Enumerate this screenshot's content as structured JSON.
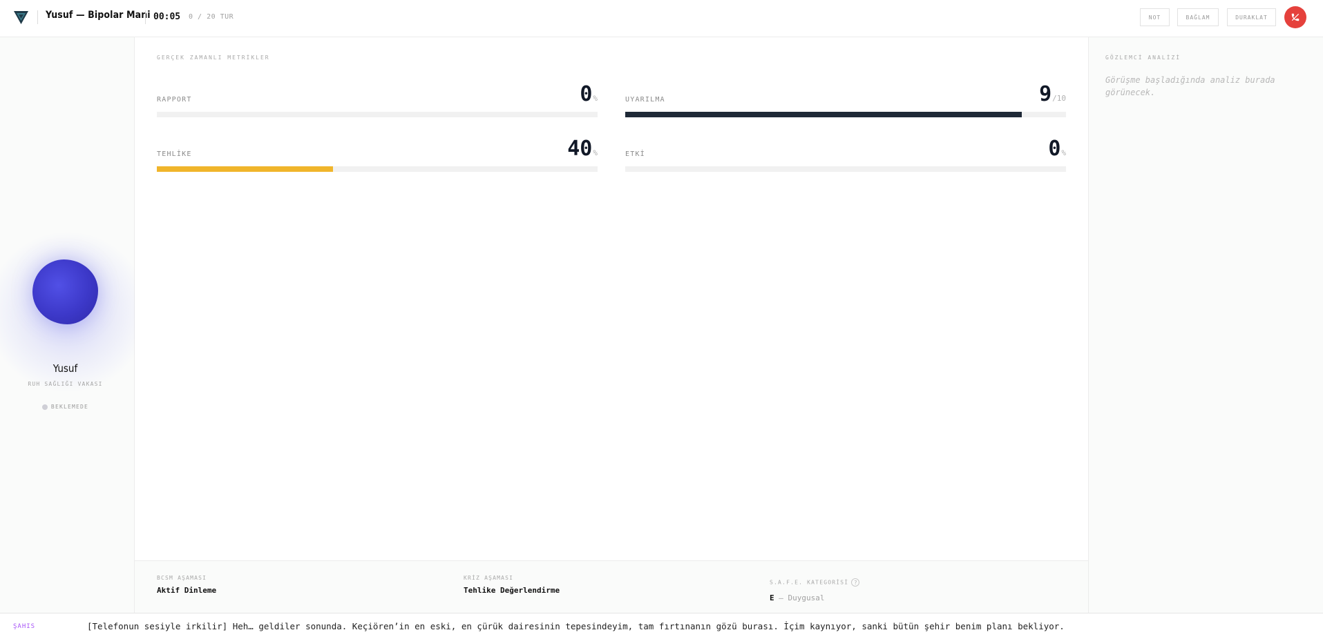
{
  "header": {
    "title": "Yusuf — Bipolar Mani",
    "timer": "00:05",
    "turns": "0 / 20 TUR",
    "buttons": {
      "note": "NOT",
      "context": "BAĞLAM",
      "pause": "DURAKLAT"
    },
    "end_call_icon": "phone-hangup-icon",
    "logo_icon": "triangle-logo-icon"
  },
  "persona": {
    "name": "Yusuf",
    "subtitle": "RUH SAĞLIĞI VAKASI",
    "status": "BEKLEMEDE"
  },
  "metrics": {
    "section_label": "GERÇEK ZAMANLI METRİKLER",
    "rapport": {
      "label": "RAPPORT",
      "value": "0",
      "unit": "%",
      "fraction": 0,
      "color": "#111827"
    },
    "arousal": {
      "label": "UYARILMA",
      "value": "9",
      "unit": "/10",
      "fraction": 0.9,
      "color": "#1f2937"
    },
    "danger": {
      "label": "TEHLİKE",
      "value": "40",
      "unit": "%",
      "fraction": 0.4,
      "color": "#f0b52b"
    },
    "impact": {
      "label": "ETKİ",
      "value": "0",
      "unit": "%",
      "fraction": 0,
      "color": "#111827"
    }
  },
  "observer": {
    "label": "GÖZLEMCİ ANALİZİ",
    "placeholder": "Görüşme başladığında analiz burada görünecek."
  },
  "info": {
    "bcsm_label": "BCSM AŞAMASI",
    "bcsm_value": "Aktif Dinleme",
    "crisis_label": "KRİZ AŞAMASI",
    "crisis_value": "Tehlike Değerlendirme",
    "safe_label": "S.A.F.E. KATEGORİSİ",
    "safe_help": "?",
    "safe_letter": "E",
    "safe_value": "— Duygusal"
  },
  "transcript": {
    "speaker": "ŞAHIS",
    "text": "[Telefonun sesiyle irkilir] Heh… geldiler sonunda. Keçiören’in en eski, en çürük dairesinin tepesindeyim, tam fırtınanın gözü burası. İçim kaynıyor, sanki bütün şehir benim planı bekliyor."
  }
}
